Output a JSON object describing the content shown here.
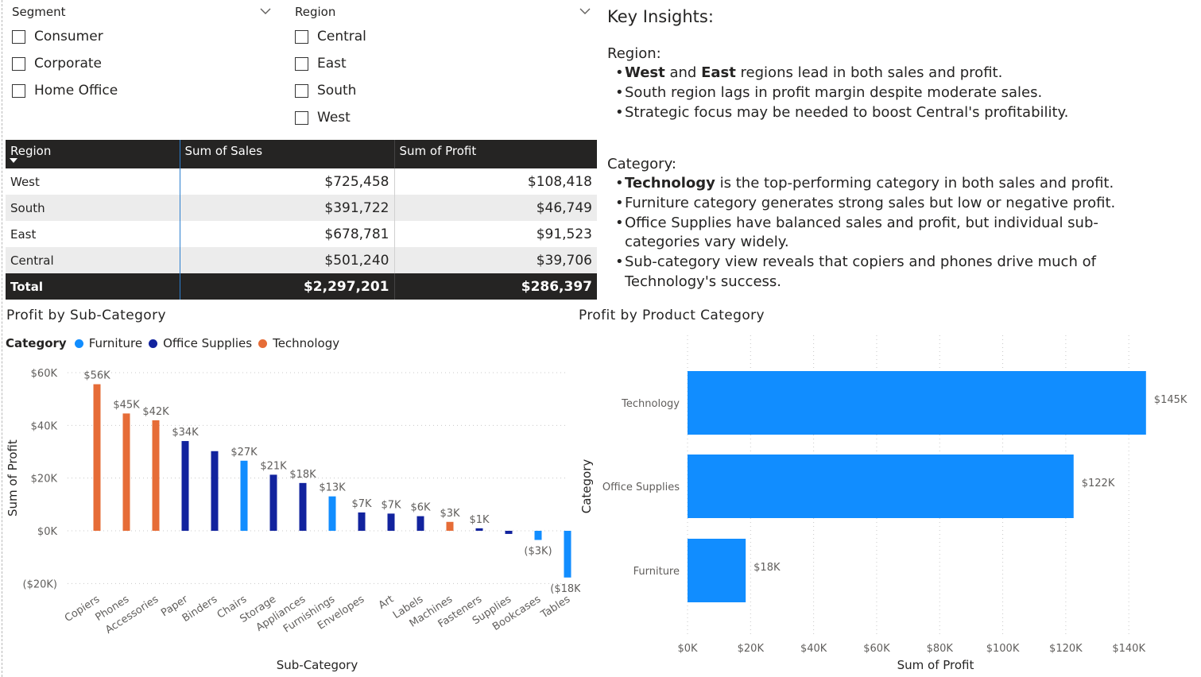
{
  "slicers": {
    "segment": {
      "title": "Segment",
      "options": [
        "Consumer",
        "Corporate",
        "Home Office"
      ]
    },
    "region": {
      "title": "Region",
      "options": [
        "Central",
        "East",
        "South",
        "West"
      ]
    }
  },
  "table": {
    "headers": [
      "Region",
      "Sum of Sales",
      "Sum of Profit"
    ],
    "rows": [
      [
        "West",
        "$725,458",
        "$108,418"
      ],
      [
        "South",
        "$391,722",
        "$46,749"
      ],
      [
        "East",
        "$678,781",
        "$91,523"
      ],
      [
        "Central",
        "$501,240",
        "$39,706"
      ]
    ],
    "total": [
      "Total",
      "$2,297,201",
      "$286,397"
    ]
  },
  "insights": {
    "title": "Key Insights:",
    "region_heading": "Region:",
    "region_bullets": [
      {
        "bold": "West",
        "mid": " and ",
        "bold2": "East",
        "rest": " regions lead in both sales and profit."
      },
      {
        "rest": "South region lags in profit margin despite moderate sales."
      },
      {
        "rest": "Strategic focus may be needed to boost Central's profitability."
      }
    ],
    "category_heading": "Category:",
    "category_bullets": [
      {
        "bold": "Technology",
        "rest": " is the top-performing category in both sales and profit."
      },
      {
        "rest": "Furniture category generates strong sales but low or negative profit."
      },
      {
        "rest": "Office Supplies have balanced sales and profit, but individual sub-categories vary widely."
      },
      {
        "rest": "Sub-category view reveals that copiers and phones drive much of Technology's success."
      }
    ]
  },
  "colors": {
    "Furniture": "#118DFF",
    "Office Supplies": "#12239E",
    "Technology": "#E66C37"
  },
  "chart_data": [
    {
      "type": "bar",
      "title": "Profit by Sub-Category",
      "xlabel": "Sub-Category",
      "ylabel": "Sum of Profit",
      "legend_title": "Category",
      "legend": [
        "Furniture",
        "Office Supplies",
        "Technology"
      ],
      "ylim": [
        -20000,
        60000
      ],
      "yticks": [
        -20000,
        0,
        20000,
        40000,
        60000
      ],
      "ytick_labels": [
        "($20K)",
        "$0K",
        "$20K",
        "$40K",
        "$60K"
      ],
      "categories": [
        "Copiers",
        "Phones",
        "Accessories",
        "Paper",
        "Binders",
        "Chairs",
        "Storage",
        "Appliances",
        "Furnishings",
        "Envelopes",
        "Art",
        "Labels",
        "Machines",
        "Fasteners",
        "Supplies",
        "Bookcases",
        "Tables"
      ],
      "series": [
        {
          "name": "Technology",
          "values": [
            55618,
            44516,
            41937,
            null,
            null,
            null,
            null,
            null,
            null,
            null,
            null,
            null,
            3385,
            null,
            null,
            null,
            null
          ]
        },
        {
          "name": "Office Supplies",
          "values": [
            null,
            null,
            null,
            34054,
            30222,
            null,
            21279,
            18138,
            null,
            6964,
            6528,
            5546,
            null,
            950,
            -1189,
            null,
            null
          ]
        },
        {
          "name": "Furniture",
          "values": [
            null,
            null,
            null,
            null,
            null,
            26590,
            null,
            null,
            13059,
            null,
            null,
            null,
            null,
            null,
            null,
            -3473,
            -17725
          ]
        }
      ],
      "data_labels": [
        "$56K",
        "$45K",
        "$42K",
        "$34K",
        "",
        "$27K",
        "$21K",
        "$18K",
        "$13K",
        "$7K",
        "$7K",
        "$6K",
        "$3K",
        "$1K",
        "",
        "($3K)",
        "($18K)"
      ]
    },
    {
      "type": "bar",
      "orientation": "horizontal",
      "title": "Profit by Product Category",
      "xlabel": "Sum of Profit",
      "ylabel": "Category",
      "xlim": [
        0,
        145000
      ],
      "xticks": [
        0,
        20000,
        40000,
        60000,
        80000,
        100000,
        120000,
        140000
      ],
      "xtick_labels": [
        "$0K",
        "$20K",
        "$40K",
        "$60K",
        "$80K",
        "$100K",
        "$120K",
        "$140K"
      ],
      "categories": [
        "Technology",
        "Office Supplies",
        "Furniture"
      ],
      "values": [
        145455,
        122491,
        18451
      ],
      "data_labels": [
        "$145K",
        "$122K",
        "$18K"
      ],
      "color": "#118DFF"
    }
  ]
}
